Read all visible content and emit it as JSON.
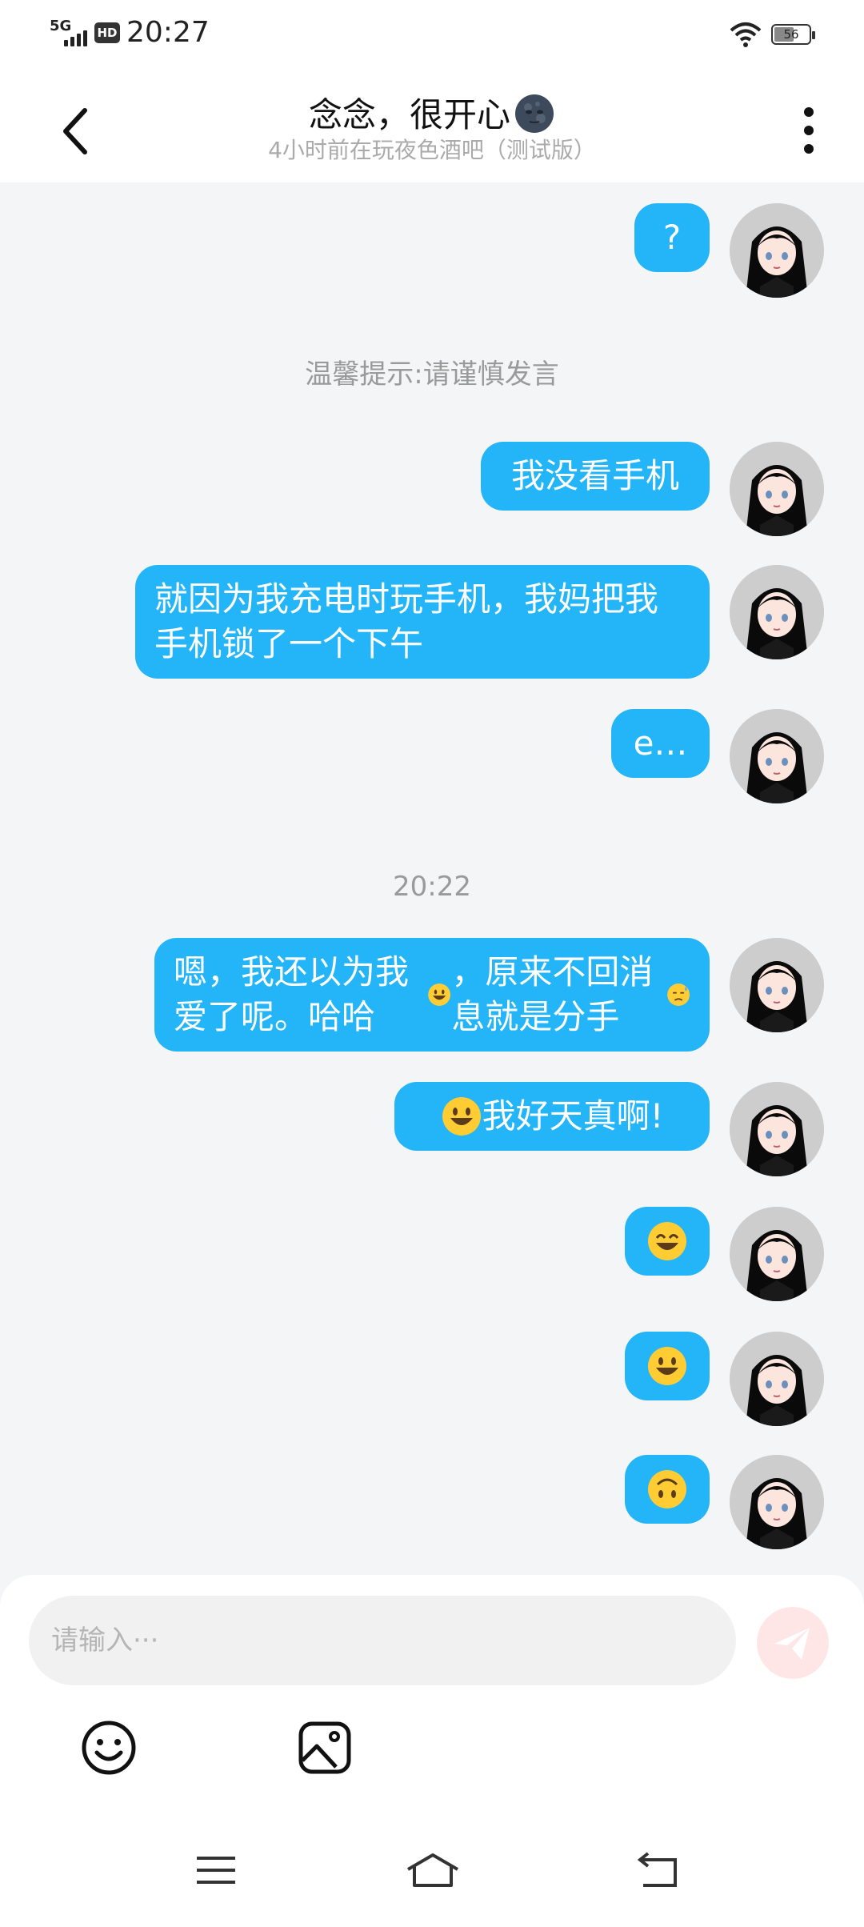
{
  "status_bar": {
    "network": "5G",
    "hd": "HD",
    "time": "20:27",
    "battery": "56"
  },
  "header": {
    "title": "念念，很开心",
    "subtitle": "4小时前在玩夜色酒吧（测试版）"
  },
  "notes": {
    "tip": "温馨提示:请谨慎发言",
    "timestamp": "20:22"
  },
  "messages": [
    {
      "text": "?"
    },
    {
      "text": "我没看手机"
    },
    {
      "text": "就因为我充电时玩手机，我妈把我手机锁了一个下午"
    },
    {
      "text": "e…"
    },
    {
      "text_a": "嗯，我还以为我爱了呢。哈哈",
      "text_b": "，原来不回消息就是分手"
    },
    {
      "text": "我好天真啊!"
    }
  ],
  "composer": {
    "placeholder": "请输入···"
  },
  "icons": {
    "back": "back-arrow-icon",
    "more": "more-vertical-icon",
    "emoji": "emoji-icon",
    "image": "image-icon",
    "send": "send-icon",
    "menu": "menu-icon",
    "home": "home-icon",
    "return": "return-icon"
  },
  "colors": {
    "bubble": "#23b5f7",
    "background": "#f4f5f7",
    "send_disabled": "#ffe6e6"
  }
}
